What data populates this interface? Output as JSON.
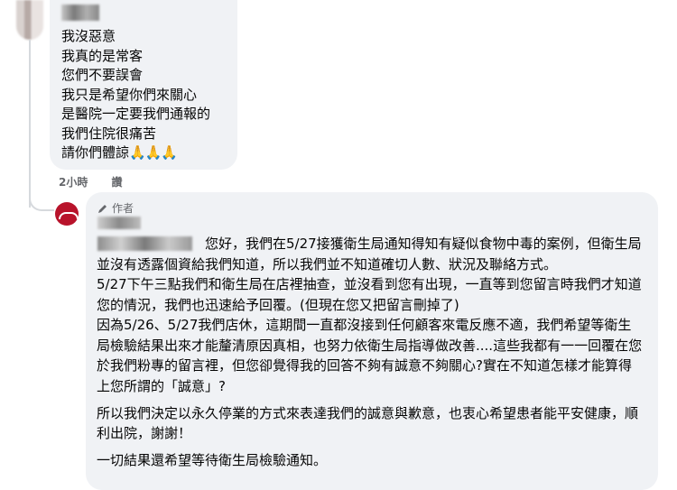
{
  "comment1": {
    "lines": [
      "我沒惡意",
      "我真的是常客",
      "您們不要誤會",
      "我只是希望你們來關心",
      "是醫院一定要我們通報的",
      "我們住院很痛苦",
      "請你們體諒"
    ],
    "emoji": "🙏🙏🙏",
    "time": "2小時",
    "like_label": "讚"
  },
  "reply": {
    "author_badge": "作者",
    "paragraphs": [
      "您好，我們在5/27接獲衛生局通知得知有疑似食物中毒的案例，但衛生局並沒有透露個資給我們知道，所以我們並不知道確切人數、狀況及聯絡方式。\n5/27下午三點我們和衛生局在店裡抽查，並沒看到您有出現，一直等到您留言時我們才知道您的情況，我們也迅速給予回覆。(但現在您又把留言刪掉了)\n因為5/26、5/27我們店休，這期間一直都沒接到任何顧客來電反應不適，我們希望等衛生局檢驗結果出來才能釐清原因真相，也努力依衛生局指導做改善....這些我都有一一回覆在您於我們粉專的留言裡，但您卻覺得我的回答不夠有誠意不夠關心?實在不知道怎樣才能算得上您所謂的「誠意」?",
      "所以我們決定以永久停業的方式來表達我們的誠意與歉意，也衷心希望患者能平安健康，順利出院，謝謝！",
      "一切結果還希望等待衛生局檢驗通知。"
    ]
  }
}
